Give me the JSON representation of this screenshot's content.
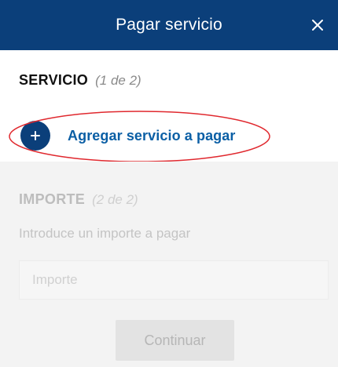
{
  "header": {
    "title": "Pagar servicio",
    "close_icon": "close-icon",
    "background": "#0b3f7a"
  },
  "service_section": {
    "heading": "SERVICIO",
    "step": "(1 de 2)",
    "add_button_label": "Agregar servicio a pagar",
    "add_icon": "plus-icon",
    "highlight_color": "#e0282e"
  },
  "amount_section": {
    "heading": "IMPORTE",
    "step": "(2 de 2)",
    "description": "Introduce un importe a pagar",
    "input_placeholder": "Importe",
    "input_value": "",
    "continue_label": "Continuar",
    "state": "disabled"
  }
}
